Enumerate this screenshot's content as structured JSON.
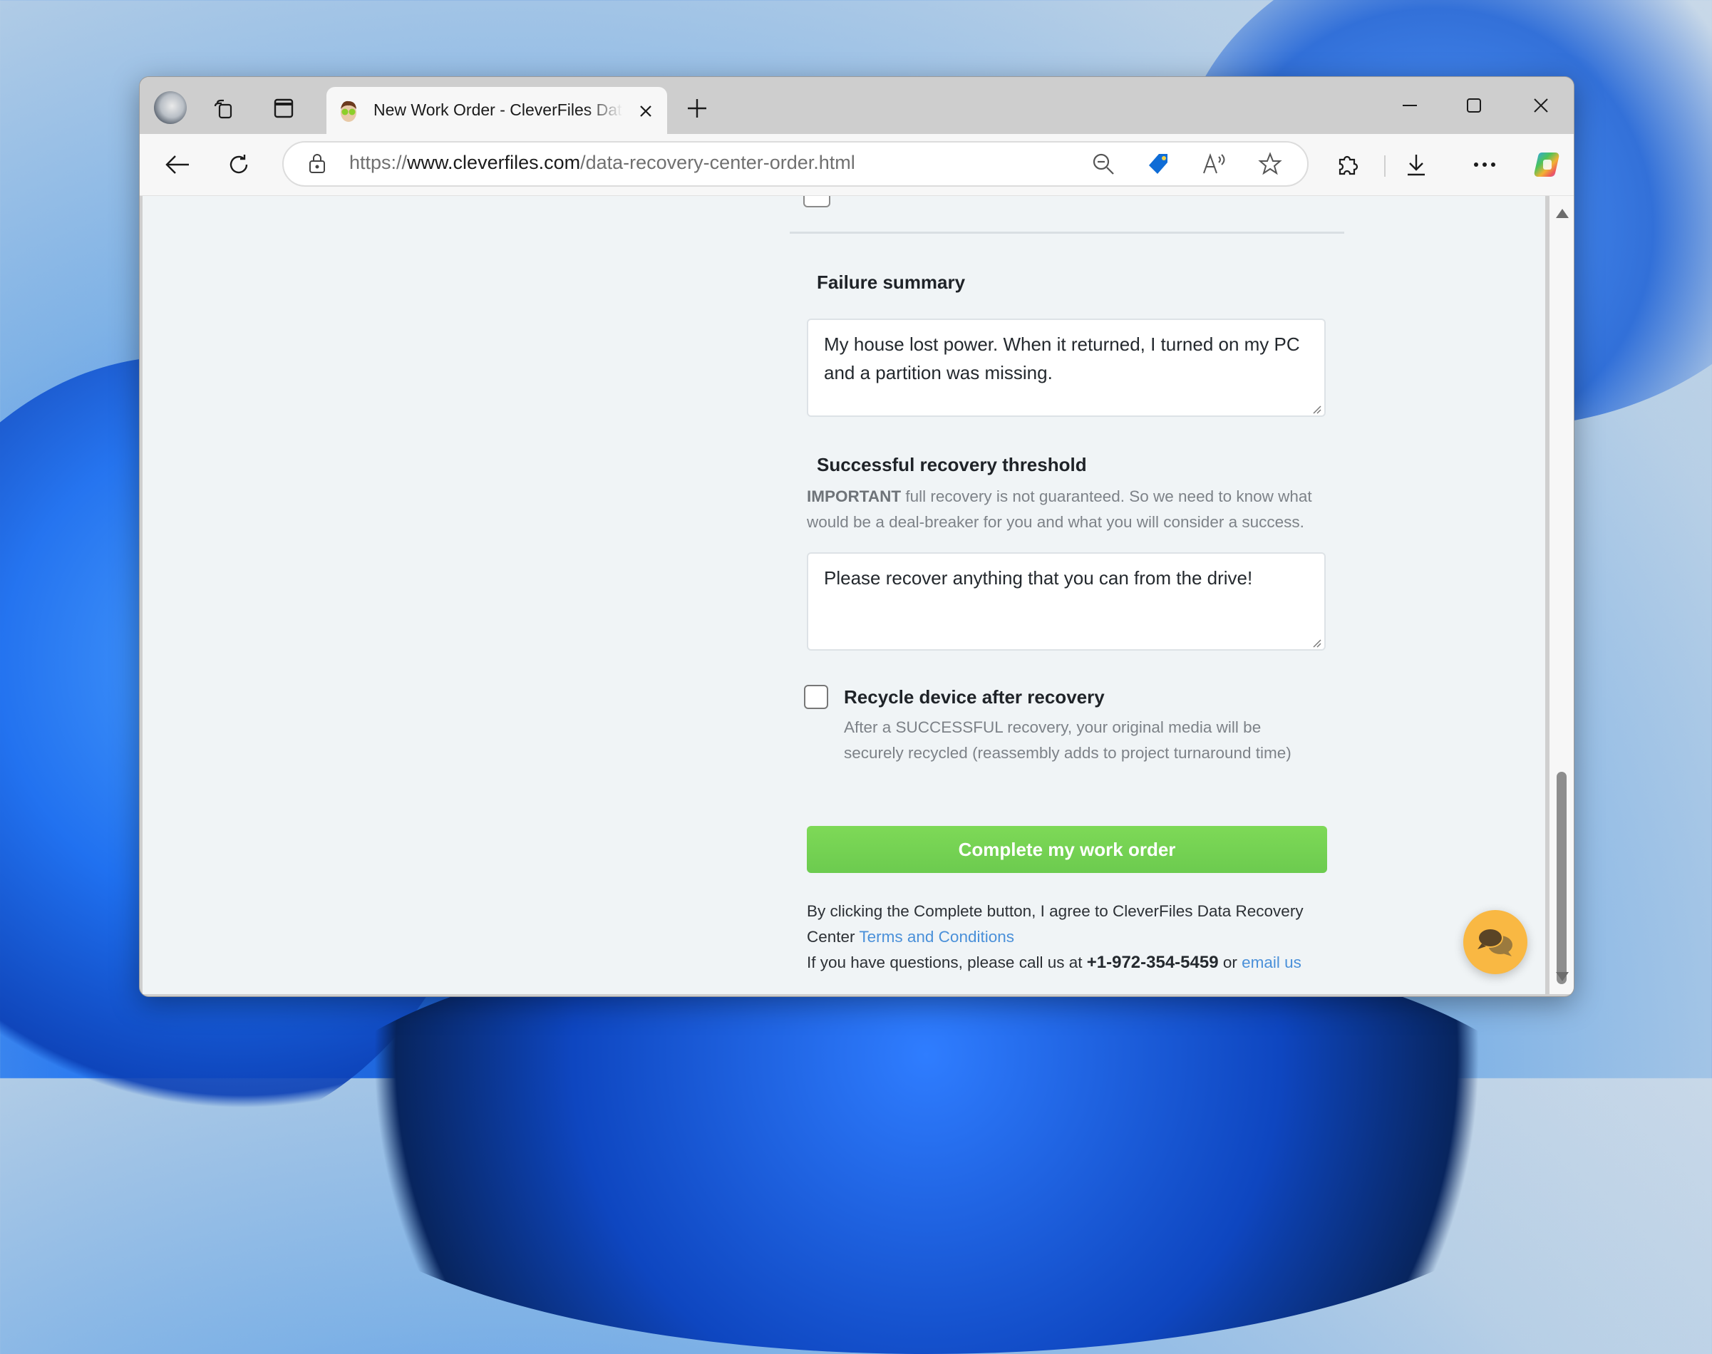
{
  "browser": {
    "tab": {
      "title": "New Work Order - CleverFiles Data Recovery Center",
      "favicon": "cleverfiles-mascot-icon"
    },
    "address_bar": {
      "scheme": "https://",
      "host": "www.cleverfiles.com",
      "path": "/data-recovery-center-order.html"
    },
    "icons": {
      "profile": "profile-avatar",
      "workspaces": "workspaces-icon",
      "vertical_tabs": "vertical-tabs-icon",
      "new_tab": "plus-icon",
      "back": "back-arrow-icon",
      "refresh": "refresh-icon",
      "lock": "lock-icon",
      "zoom_out": "zoom-out-icon",
      "shopping": "shopping-tag-icon",
      "read_aloud": "read-aloud-icon",
      "favorite": "star-icon",
      "extensions": "puzzle-icon",
      "downloads": "download-icon",
      "more": "ellipsis-icon",
      "copilot": "copilot-icon"
    }
  },
  "form": {
    "failure_summary": {
      "label": "Failure summary",
      "value": "My house lost power. When it returned, I turned on my PC and a partition was missing."
    },
    "recovery_threshold": {
      "label": "Successful recovery threshold",
      "help_strong": "IMPORTANT",
      "help_text": " full recovery is not guaranteed. So we need to know what would be a deal-breaker for you and what you will consider a success.",
      "value": "Please recover anything that you can from the drive!"
    },
    "recycle": {
      "label": "Recycle device after recovery",
      "checked": false,
      "help": "After a SUCCESSFUL recovery, your original media will be securely recycled (reassembly adds to project turnaround time)"
    },
    "submit_label": "Complete my work order",
    "legal": {
      "agree_text": "By clicking the Complete button, I agree to CleverFiles Data Recovery Center ",
      "terms_link": "Terms and Conditions",
      "questions_text": "If you have questions, please call us at ",
      "phone": "+1-972-354-5459",
      "or_text": " or ",
      "email_link": "email us"
    }
  },
  "chat_widget": {
    "icon": "chat-bubbles-icon"
  },
  "colors": {
    "submit_button": "#6ccb4f",
    "link": "#4a90d9",
    "chat_fab": "#f9b843",
    "page_background": "#f0f4f6"
  }
}
